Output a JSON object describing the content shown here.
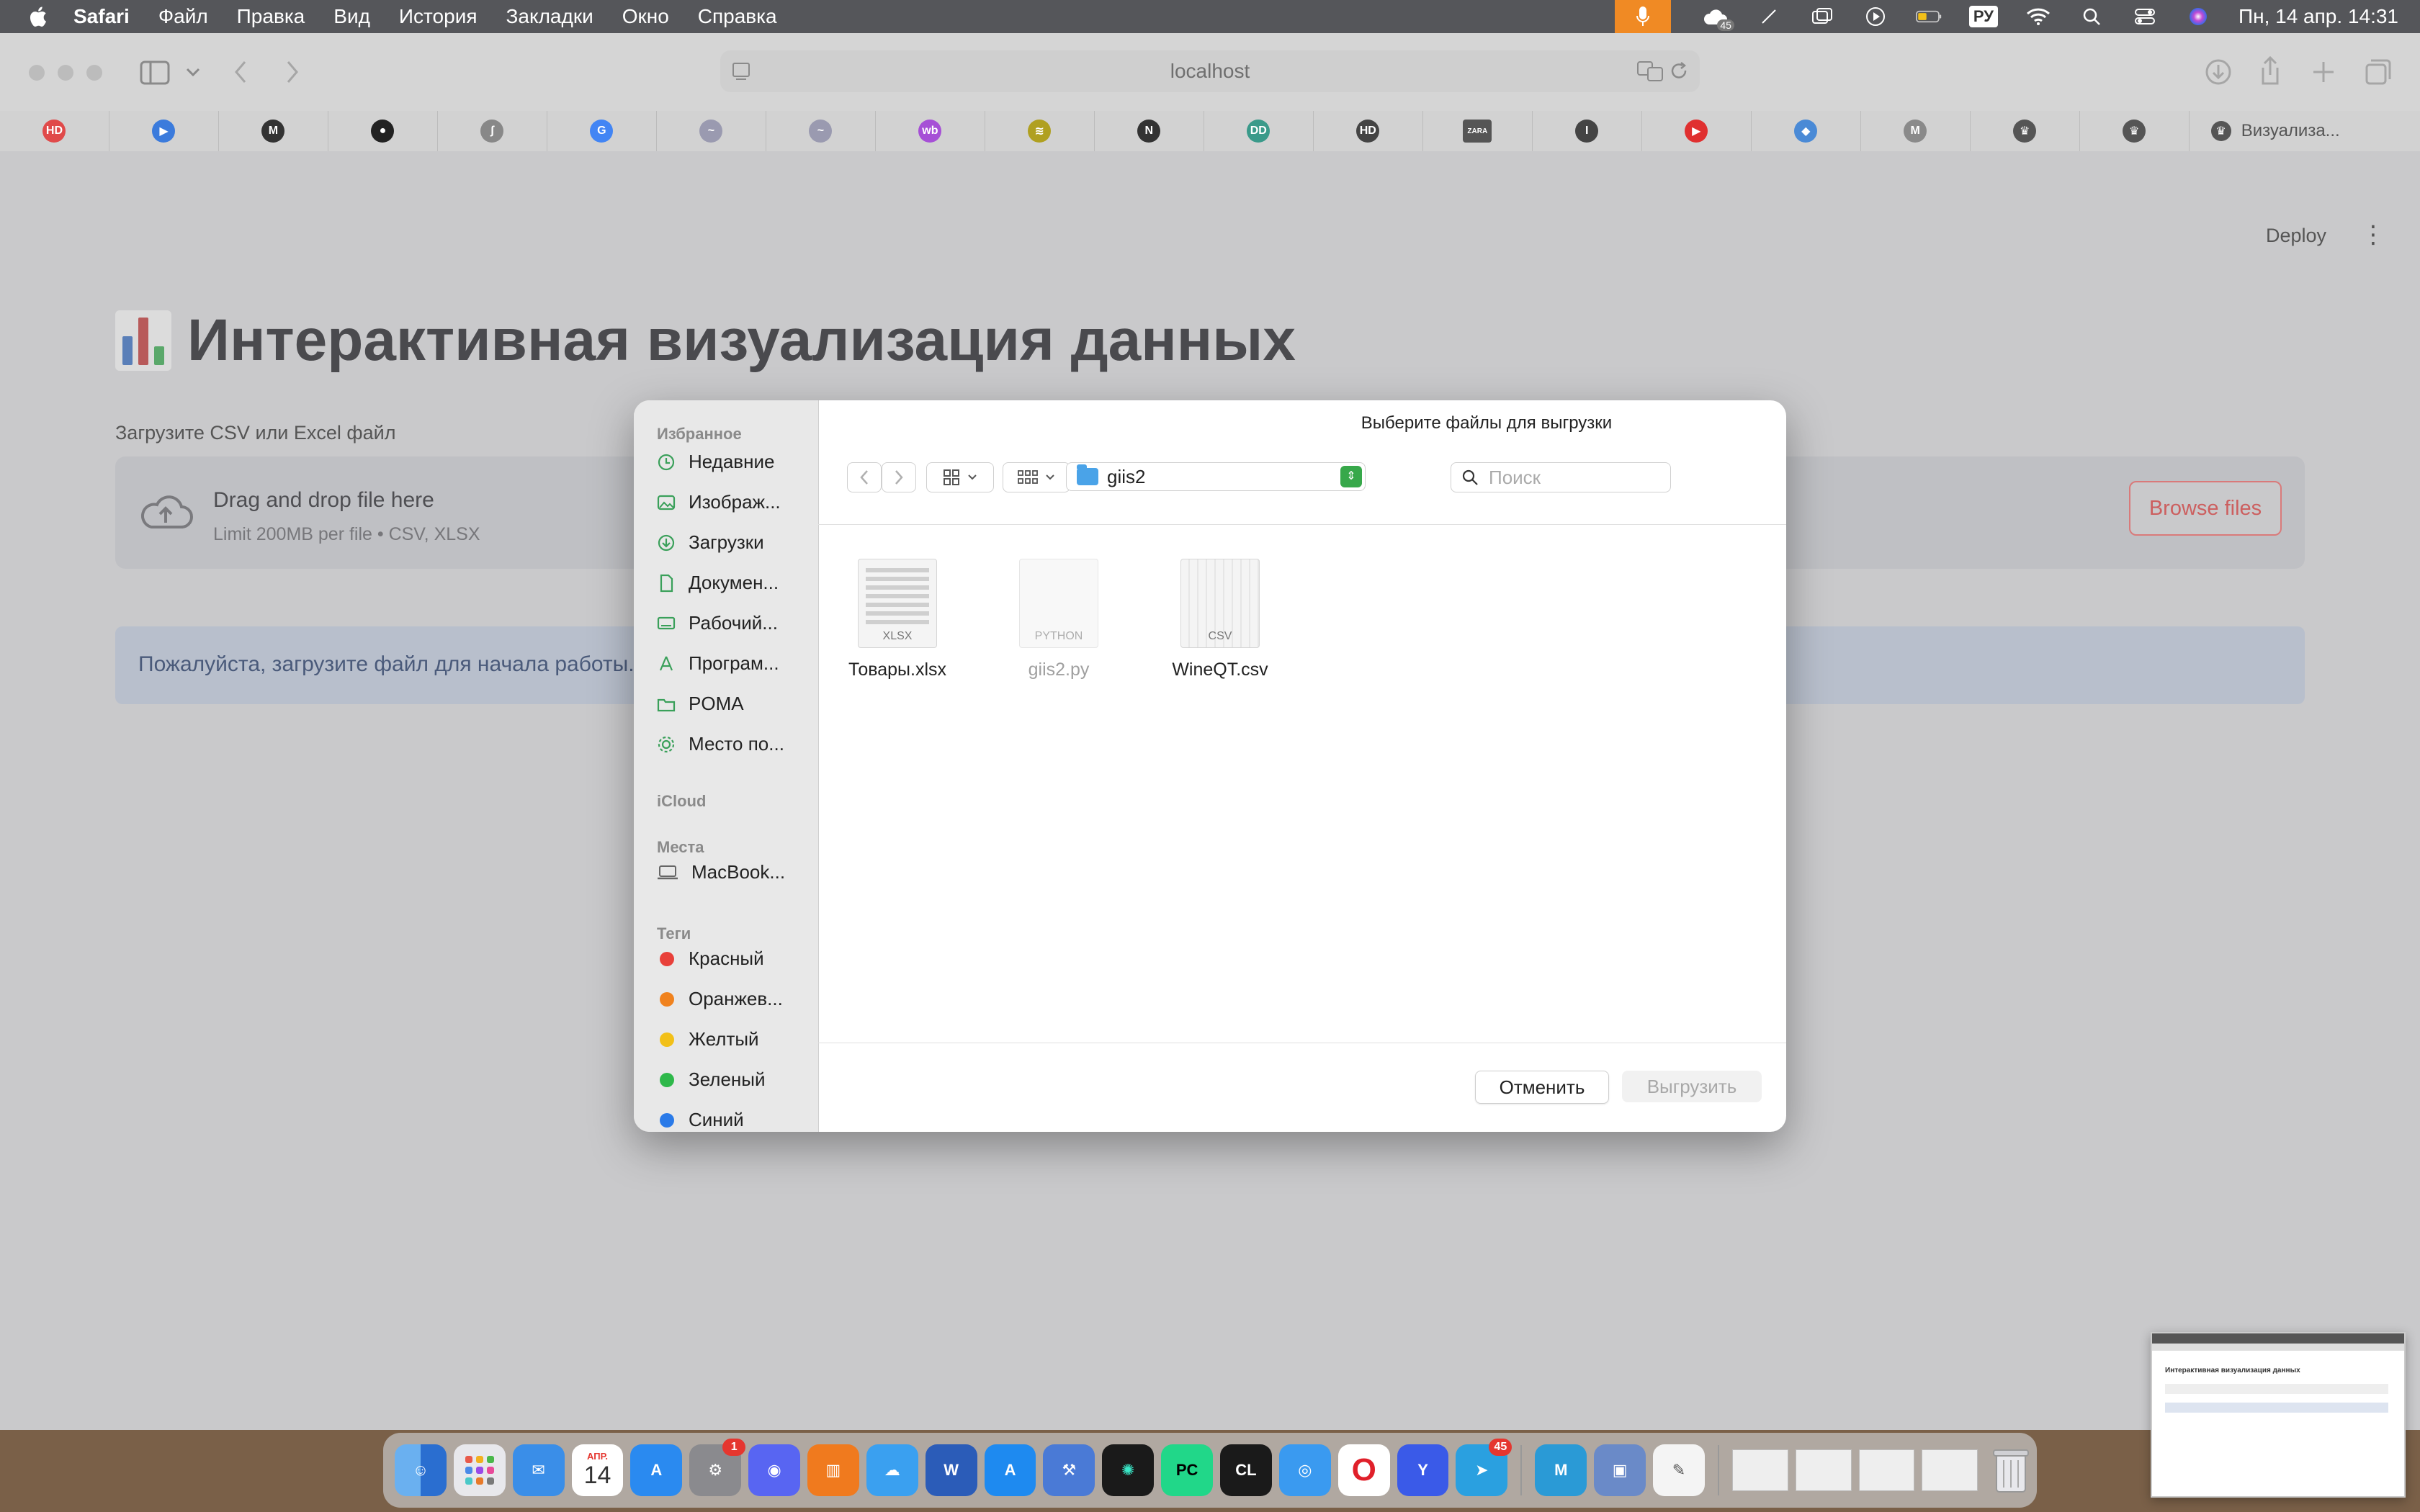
{
  "menubar": {
    "app": "Safari",
    "items": [
      "Файл",
      "Правка",
      "Вид",
      "История",
      "Закладки",
      "Окно",
      "Справка"
    ],
    "notification_badge": "45",
    "lang": "РУ",
    "clock": "Пн, 14 апр. 14:31"
  },
  "browser": {
    "address": "localhost",
    "favorites": [
      {
        "icon": "hd-icon",
        "text": "HD",
        "color": "#e04a4a"
      },
      {
        "icon": "play-icon",
        "text": "▶",
        "color": "#3b7bdc"
      },
      {
        "icon": "m-icon",
        "text": "M",
        "color": "#333333"
      },
      {
        "icon": "github-icon",
        "text": "●",
        "color": "#222222"
      },
      {
        "icon": "feather-icon",
        "text": "ʃ",
        "color": "#888888"
      },
      {
        "icon": "google-icon",
        "text": "G",
        "color": "#4285f4"
      },
      {
        "icon": "site-icon",
        "text": "~",
        "color": "#9a9ab0"
      },
      {
        "icon": "site-icon",
        "text": "~",
        "color": "#9a9ab0"
      },
      {
        "icon": "wildberries-icon",
        "text": "wb",
        "color": "#a64fd6"
      },
      {
        "icon": "layers-icon",
        "text": "≋",
        "color": "#b0a020"
      },
      {
        "icon": "notion-icon",
        "text": "N",
        "color": "#333333"
      },
      {
        "icon": "dd-icon",
        "text": "DD",
        "color": "#3a9a8a"
      },
      {
        "icon": "hd-text-icon",
        "text": "HD",
        "color": "#444444"
      },
      {
        "icon": "zara-icon",
        "text": "ZARA",
        "color": "#555555"
      },
      {
        "icon": "site-icon",
        "text": "I",
        "color": "#444444"
      },
      {
        "icon": "youtube-icon",
        "text": "▶",
        "color": "#e03030"
      },
      {
        "icon": "shield-icon",
        "text": "◆",
        "color": "#4a8ad6"
      },
      {
        "icon": "m-gray-icon",
        "text": "M",
        "color": "#8a8a8a"
      },
      {
        "icon": "crown-icon",
        "text": "♛",
        "color": "#555555"
      },
      {
        "icon": "crown-icon",
        "text": "♛",
        "color": "#555555"
      }
    ],
    "last_tab": "Визуализа..."
  },
  "page": {
    "deploy": "Deploy",
    "title": "Интерактивная визуализация данных",
    "upload_label": "Загрузите CSV или Excel файл",
    "drop_title": "Drag and drop file here",
    "drop_sub": "Limit 200MB per file • CSV, XLSX",
    "browse": "Browse files",
    "info": "Пожалуйста, загрузите файл для начала работы."
  },
  "dialog": {
    "title": "Выберите файлы для выгрузки",
    "sidebar": {
      "favorites_label": "Избранное",
      "favorites": [
        {
          "label": "Недавние",
          "icon": "clock-icon"
        },
        {
          "label": "Изображ...",
          "icon": "photo-icon"
        },
        {
          "label": "Загрузки",
          "icon": "download-icon"
        },
        {
          "label": "Докумен...",
          "icon": "document-icon"
        },
        {
          "label": "Рабочий...",
          "icon": "desktop-icon"
        },
        {
          "label": "Програм...",
          "icon": "applications-icon"
        },
        {
          "label": "POMA",
          "icon": "folder-icon"
        },
        {
          "label": "Место по...",
          "icon": "gear-icon"
        }
      ],
      "icloud_label": "iCloud",
      "places_label": "Места",
      "places": [
        {
          "label": "MacBook...",
          "icon": "laptop-icon"
        }
      ],
      "tags_label": "Теги",
      "tags": [
        {
          "label": "Красный",
          "color": "#e8403a"
        },
        {
          "label": "Оранжев...",
          "color": "#f0821e"
        },
        {
          "label": "Желтый",
          "color": "#f2c018"
        },
        {
          "label": "Зеленый",
          "color": "#2eb84a"
        },
        {
          "label": "Синий",
          "color": "#2a7ae8"
        }
      ]
    },
    "folder": "giis2",
    "search_placeholder": "Поиск",
    "files": [
      {
        "name": "Товары.xlsx",
        "ext": "XLSX",
        "disabled": false
      },
      {
        "name": "giis2.py",
        "ext": "PYTHON",
        "disabled": true
      },
      {
        "name": "WineQT.csv",
        "ext": "CSV",
        "disabled": false
      }
    ],
    "cancel": "Отменить",
    "upload": "Выгрузить"
  },
  "dock": {
    "calendar_month": "АПР.",
    "calendar_day": "14",
    "settings_badge": "1",
    "telegram_badge": "45"
  }
}
